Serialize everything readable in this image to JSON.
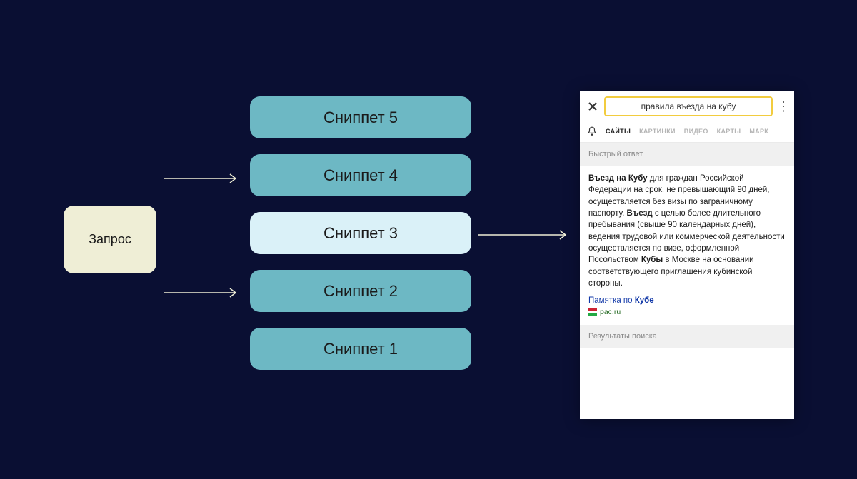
{
  "query": {
    "label": "Запрос"
  },
  "snippets": [
    {
      "label": "Сниппет 5",
      "highlight": false
    },
    {
      "label": "Сниппет 4",
      "highlight": false
    },
    {
      "label": "Сниппет 3",
      "highlight": true
    },
    {
      "label": "Сниппет 2",
      "highlight": false
    },
    {
      "label": "Сниппет 1",
      "highlight": false
    }
  ],
  "phone": {
    "search_value": "правила въезда на кубу",
    "tabs": [
      "САЙТЫ",
      "КАРТИНКИ",
      "ВИДЕО",
      "КАРТЫ",
      "МАРК"
    ],
    "quick_answer_label": "Быстрый ответ",
    "answer_prefix_bold": "Въезд на Кубу",
    "answer_part1": " для граждан Российской Федерации на срок, не превышающий 90 дней, осуществляется без визы по заграничному паспорту. ",
    "answer_mid_bold": "Въезд",
    "answer_part2": " с целью более длительного пребывания (свыше 90 календарных дней), ведения трудовой или коммерческой деятельности осуществляется по визе, оформленной Посольством ",
    "answer_end_bold": "Кубы",
    "answer_part3": " в Москве на основании соответствующего приглашения кубинской стороны.",
    "link_text_prefix": "Памятка по ",
    "link_text_bold": "Кубе",
    "site": "pac.ru",
    "results_label": "Результаты поиска"
  }
}
